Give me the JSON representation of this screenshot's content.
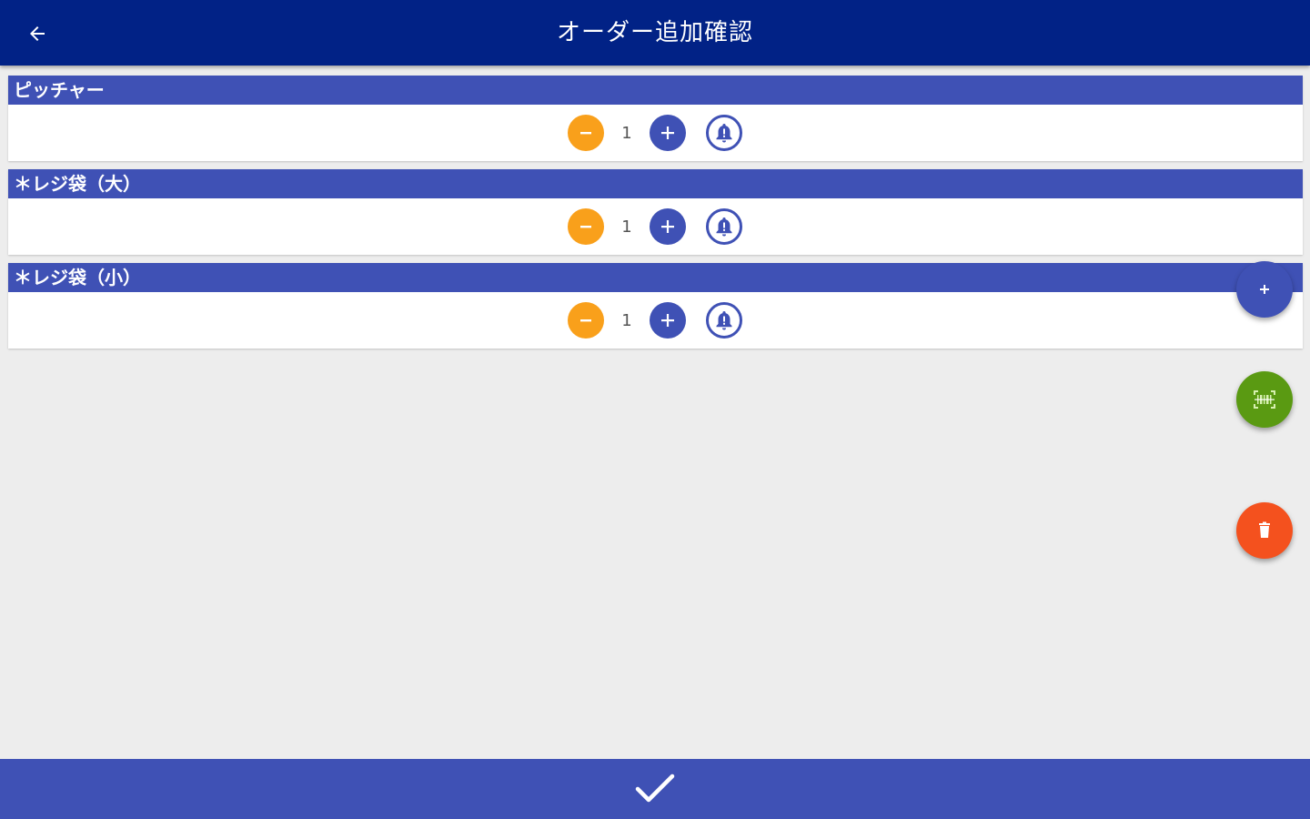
{
  "app_bar": {
    "title": "オーダー追加確認",
    "back_icon": "arrow-left-icon",
    "background": "#012286"
  },
  "items": [
    {
      "name": "ピッチャー",
      "quantity": "1"
    },
    {
      "name": "＊レジ袋（大）",
      "quantity": "1"
    },
    {
      "name": "＊レジ袋（小）",
      "quantity": "1"
    }
  ],
  "item_controls": {
    "minus_icon": "minus-icon",
    "plus_icon": "plus-icon",
    "bell_icon": "bell-alert-icon"
  },
  "fabs": {
    "add_icon": "plus-icon",
    "scan_icon": "barcode-scan-icon",
    "delete_icon": "trash-icon"
  },
  "bottom_bar": {
    "confirm_icon": "check-icon"
  },
  "colors": {
    "primary": "#3f51b5",
    "app_bar": "#012286",
    "minus": "#f9a01b",
    "scan": "#5a9a12",
    "delete": "#f4511e",
    "background": "#ededed"
  }
}
